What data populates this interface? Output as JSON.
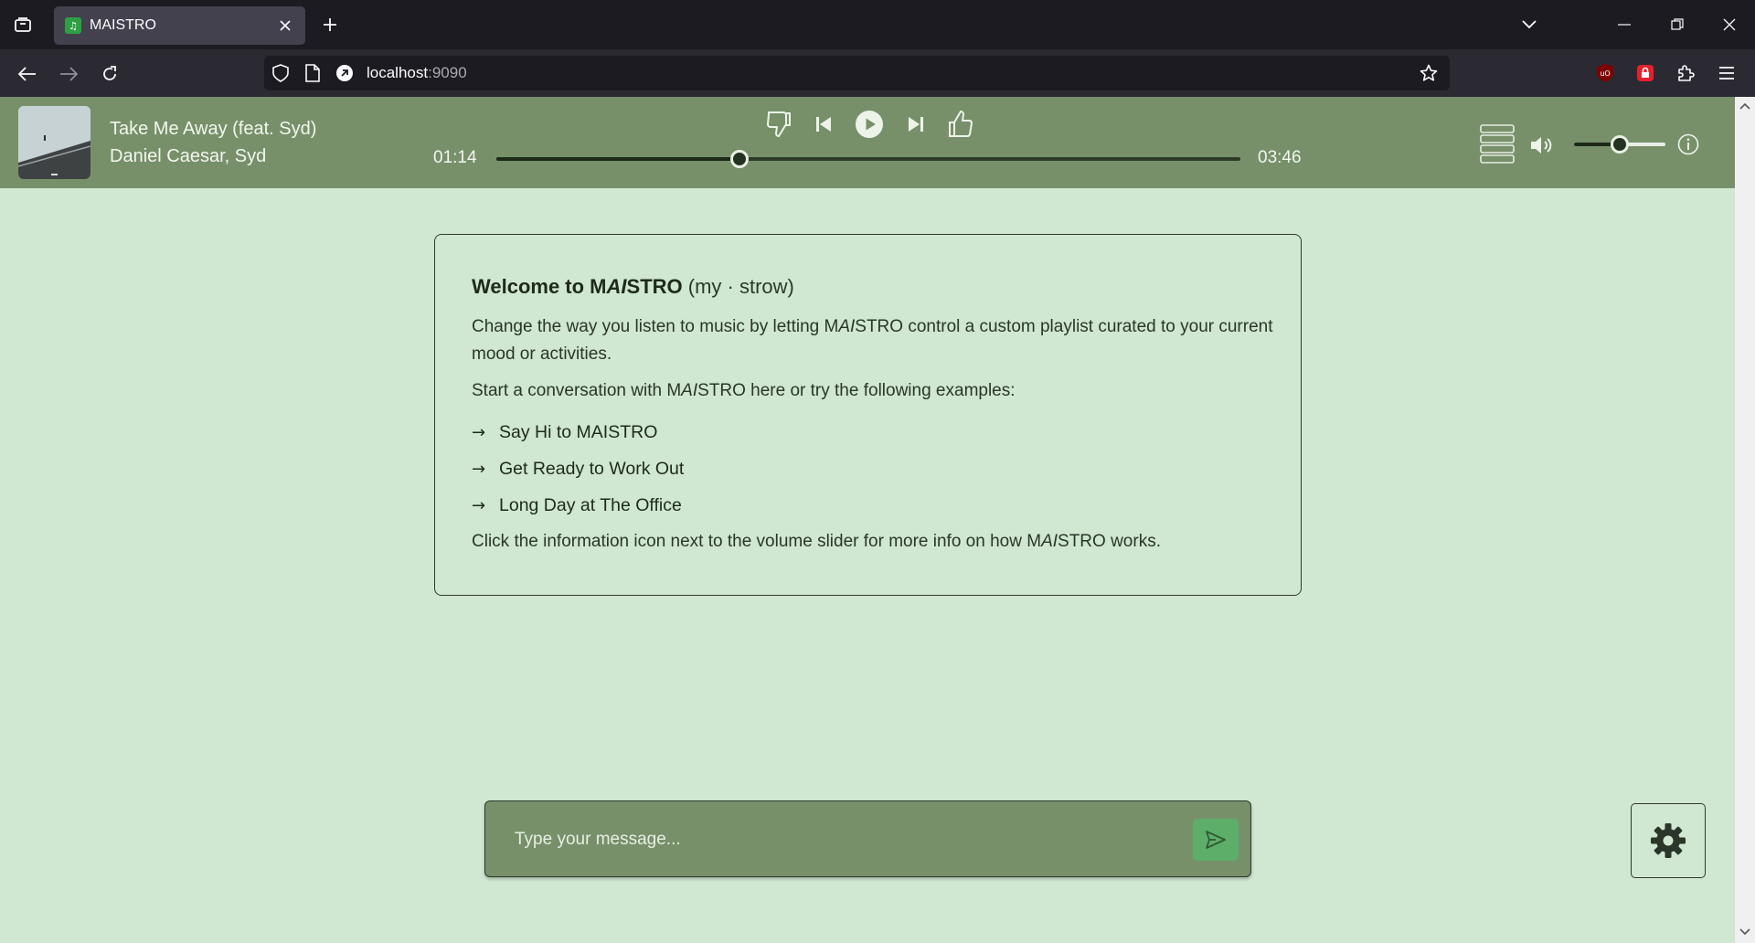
{
  "browser": {
    "tab_title": "MAISTRO",
    "url_host": "localhost",
    "url_port": ":9090",
    "icons": [
      "list-all-tabs-icon",
      "favicon",
      "close-icon",
      "plus-icon",
      "chevron-down-icon",
      "minimize-icon",
      "restore-icon",
      "close-window-icon",
      "back-icon",
      "forward-icon",
      "reload-icon",
      "shield-icon",
      "page-icon",
      "connection-icon",
      "star-icon",
      "ublock-icon",
      "lock-extension-icon",
      "extensions-icon",
      "menu-icon"
    ]
  },
  "player": {
    "track_title": "Take Me Away (feat. Syd)",
    "track_artist": "Daniel Caesar, Syd",
    "time_current": "01:14",
    "time_total": "03:46",
    "progress_fraction": 0.327,
    "volume_fraction": 0.5,
    "accent": "#77906a"
  },
  "welcome": {
    "title_prefix": "Welcome to M",
    "title_ai": "AI",
    "title_suffix": "STRO",
    "pronunciation": "(my · strow)",
    "para1_a": "Change the way you listen to music by letting M",
    "para1_ai": "AI",
    "para1_b": "STRO control a custom playlist curated to your current mood or activities.",
    "para2_a": "Start a conversation with M",
    "para2_ai": "AI",
    "para2_b": "STRO here or try the following examples:",
    "examples": [
      "Say Hi to MAISTRO",
      "Get Ready to Work Out",
      "Long Day at The Office"
    ],
    "para3_a": "Click the information icon next to the volume slider for more info on how M",
    "para3_ai": "AI",
    "para3_b": "STRO works."
  },
  "composer": {
    "placeholder": "Type your message...",
    "send_color": "#5cae68"
  },
  "colors": {
    "page_bg": "#d0e7d2",
    "player_bg": "#77906a"
  }
}
